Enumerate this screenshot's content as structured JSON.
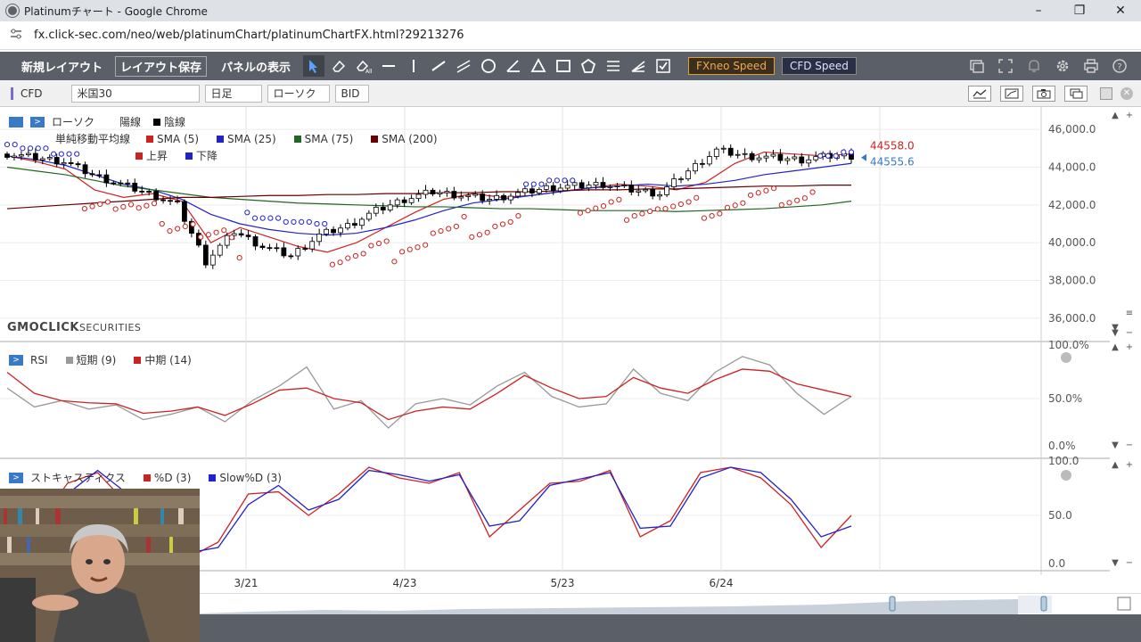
{
  "window": {
    "title": "Platinumチャート - Google Chrome",
    "minimize": "–",
    "restore": "❐",
    "close": "✕"
  },
  "address": {
    "url": "fx.click-sec.com/neo/web/platinumChart/platinumChartFX.html?29213276"
  },
  "toolbar": {
    "new_layout": "新規レイアウト",
    "save_layout": "レイアウト保存",
    "panel_display": "パネルの表示",
    "fxneo_speed": "FXneo Speed",
    "cfd_speed": "CFD Speed"
  },
  "symbolbar": {
    "market": "CFD",
    "symbol": "米国30",
    "period": "日足",
    "chart_type": "ローソク",
    "price_type": "BID"
  },
  "main_legend": {
    "candle_label": "ローソク",
    "up_label": "陽線",
    "down_label": "陰線",
    "sma_label": "単純移動平均線",
    "sma5": "SMA (5)",
    "sma25": "SMA (25)",
    "sma75": "SMA (75)",
    "sma200": "SMA (200)",
    "psar_up": "上昇",
    "psar_down": "下降"
  },
  "brand": {
    "logo": "GMOCLICK",
    "logo_suffix": "SECURITIES"
  },
  "price_axis": {
    "ticks": [
      "46,000.0",
      "44,000.0",
      "42,000.0",
      "40,000.0",
      "38,000.0",
      "36,000.0"
    ],
    "last_ask": "44558.0",
    "last_bid": "44555.6"
  },
  "rsi_panel": {
    "title": "RSI",
    "short": "短期 (9)",
    "mid": "中期 (14)",
    "ticks": [
      "100.0%",
      "50.0%",
      "0.0%"
    ]
  },
  "stoch_panel": {
    "title": "ストキャスティクス",
    "pctd": "%D (3)",
    "slowd": "Slow%D (3)",
    "ticks": [
      "100.0",
      "50.0",
      "0.0"
    ]
  },
  "date_axis": {
    "ticks": [
      "3/21",
      "4/23",
      "5/23",
      "6/24"
    ]
  },
  "colors": {
    "up": "#ffffff",
    "down": "#000000",
    "sma5": "#cc2222",
    "sma25": "#2222cc",
    "sma75": "#226622",
    "sma200": "#660000",
    "toolbar": "#5b6068",
    "accent": "#3a79c6"
  },
  "chart_data": [
    {
      "type": "candlestick",
      "title": "米国30",
      "ylim": [
        35000,
        47000
      ],
      "x": [
        "3/21",
        "4/23",
        "5/23",
        "6/24"
      ],
      "series": [
        {
          "name": "SMA (5)",
          "values": [
            44600,
            44300,
            43900,
            42800,
            42400,
            42600,
            42200,
            40000,
            40800,
            40300,
            39800,
            39500,
            40000,
            40800,
            41600,
            42300,
            42600,
            42400,
            42500,
            42700,
            42900,
            43100,
            43000,
            42800,
            43200,
            44200,
            44800,
            44700,
            44600,
            44700
          ]
        },
        {
          "name": "SMA (25)",
          "values": [
            44600,
            44400,
            44100,
            43600,
            43100,
            42800,
            42300,
            41500,
            41000,
            40700,
            40500,
            40400,
            40500,
            40800,
            41200,
            41700,
            42100,
            42300,
            42500,
            42700,
            42900,
            43000,
            43100,
            43000,
            43100,
            43300,
            43600,
            43800,
            44000,
            44200
          ]
        },
        {
          "name": "SMA (75)",
          "values": [
            44000,
            43800,
            43600,
            43300,
            43000,
            42800,
            42600,
            42400,
            42300,
            42200,
            42100,
            42050,
            42000,
            41950,
            41900,
            41900,
            41850,
            41800,
            41800,
            41750,
            41700,
            41700,
            41700,
            41650,
            41700,
            41750,
            41800,
            41900,
            42000,
            42200
          ]
        },
        {
          "name": "SMA (200)",
          "values": [
            41800,
            41900,
            42000,
            42100,
            42200,
            42300,
            42400,
            42400,
            42450,
            42500,
            42500,
            42550,
            42550,
            42600,
            42600,
            42650,
            42650,
            42700,
            42700,
            42750,
            42800,
            42800,
            42850,
            42850,
            42900,
            42950,
            43000,
            43000,
            43050,
            43050
          ]
        }
      ],
      "ohlc_close": [
        44700,
        44500,
        44300,
        43600,
        43100,
        42600,
        42000,
        39000,
        40600,
        39800,
        39300,
        40400,
        40900,
        41700,
        42300,
        42700,
        42500,
        42300,
        42600,
        42900,
        43000,
        43100,
        42800,
        42600,
        43800,
        44900,
        44600,
        44500,
        44400,
        44600
      ]
    },
    {
      "type": "line",
      "title": "RSI",
      "ylim": [
        0,
        100
      ],
      "series": [
        {
          "name": "短期 (9)",
          "values": [
            60,
            42,
            48,
            40,
            44,
            30,
            35,
            42,
            28,
            48,
            62,
            80,
            40,
            48,
            22,
            45,
            50,
            44,
            62,
            75,
            52,
            42,
            45,
            78,
            55,
            48,
            75,
            90,
            82,
            55,
            35,
            52
          ]
        },
        {
          "name": "中期 (14)",
          "values": [
            75,
            55,
            48,
            46,
            45,
            36,
            38,
            42,
            34,
            45,
            58,
            60,
            50,
            46,
            30,
            38,
            42,
            40,
            55,
            72,
            60,
            50,
            52,
            70,
            60,
            55,
            68,
            78,
            76,
            64,
            58,
            52
          ]
        }
      ]
    },
    {
      "type": "line",
      "title": "ストキャスティクス",
      "ylim": [
        0,
        100
      ],
      "series": [
        {
          "name": "%D (3)",
          "values": [
            15,
            40,
            80,
            90,
            60,
            35,
            10,
            25,
            70,
            72,
            50,
            70,
            95,
            85,
            80,
            90,
            30,
            55,
            80,
            82,
            92,
            30,
            45,
            90,
            95,
            85,
            60,
            20,
            50
          ]
        },
        {
          "name": "Slow%D (3)",
          "values": [
            10,
            30,
            70,
            92,
            70,
            40,
            15,
            20,
            60,
            78,
            55,
            65,
            92,
            88,
            82,
            88,
            40,
            45,
            78,
            84,
            90,
            38,
            40,
            85,
            95,
            90,
            65,
            30,
            40
          ]
        }
      ]
    }
  ]
}
